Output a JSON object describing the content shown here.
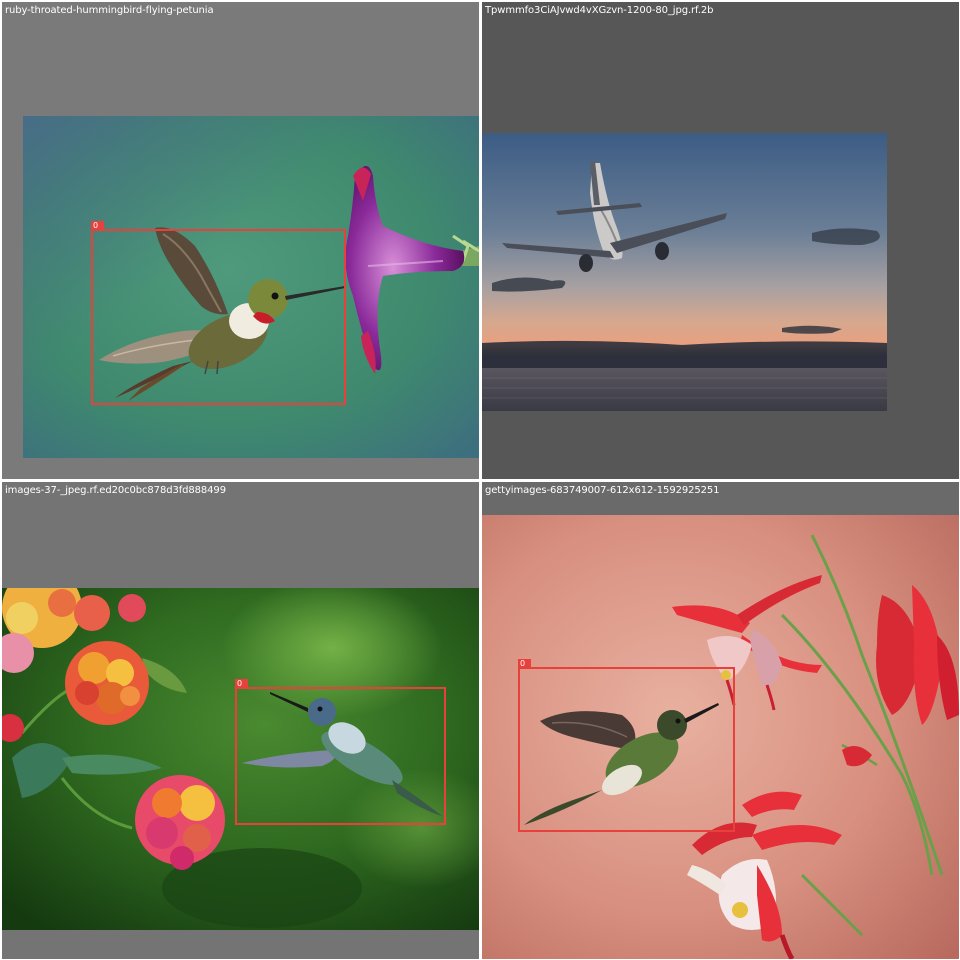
{
  "panels": [
    {
      "filename": "ruby-throated-hummingbird-flying-petunia",
      "scene": "ruby-throated hummingbird hovering beside a purple petunia flower",
      "detection_label": "0",
      "box_color": "#e8403a"
    },
    {
      "filename": "Tpwmmfo3CiAJvwd4vXGzvn-1200-80_jpg.rf.2b",
      "scene": "jet airliner flying over sea at dusk"
    },
    {
      "filename": "images-37-_jpeg.rf.ed20c0bc878d3fd888499",
      "scene": "hummingbird hovering near orange and pink lantana flowers",
      "detection_label": "0",
      "box_color": "#e8403a"
    },
    {
      "filename": "gettyimages-683749007-612x612-1592925251",
      "scene": "hummingbird feeding at red columbine flowers on a pink background",
      "detection_label": "0",
      "box_color": "#e8403a"
    }
  ],
  "colors": {
    "grid_background": "#ffffff",
    "bbox": "#e8403a",
    "title_text": "#ffffff"
  }
}
